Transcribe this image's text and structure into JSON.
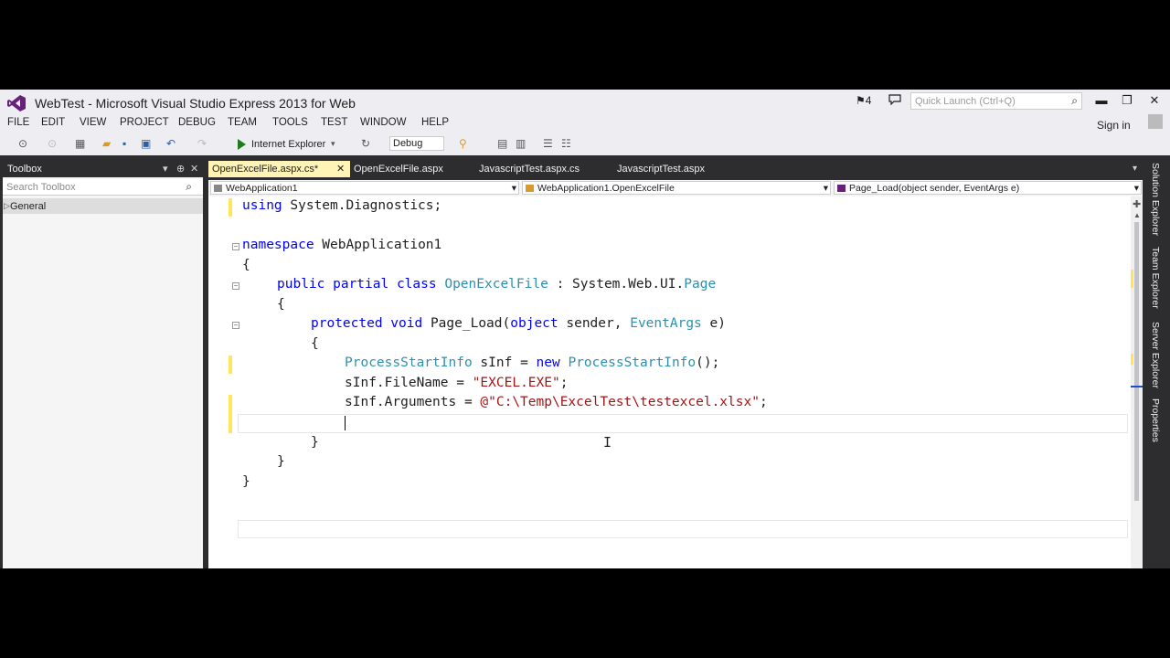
{
  "window": {
    "title": "WebTest - Microsoft Visual Studio Express 2013 for Web",
    "notification_count": "4",
    "quick_launch_placeholder": "Quick Launch (Ctrl+Q)",
    "sign_in": "Sign in"
  },
  "menu": [
    "FILE",
    "EDIT",
    "VIEW",
    "PROJECT",
    "DEBUG",
    "TEAM",
    "TOOLS",
    "TEST",
    "WINDOW",
    "HELP"
  ],
  "toolbar": {
    "browser": "Internet Explorer",
    "config": "Debug"
  },
  "toolbox": {
    "title": "Toolbox",
    "search_placeholder": "Search Toolbox",
    "group": "General"
  },
  "tabs": [
    "OpenExcelFile.aspx.cs*",
    "OpenExcelFile.aspx",
    "JavascriptTest.aspx.cs",
    "JavascriptTest.aspx"
  ],
  "navbar": {
    "project": "WebApplication1",
    "class": "WebApplication1.OpenExcelFile",
    "member": "Page_Load(object sender, EventArgs e)"
  },
  "side_panels": [
    "Solution Explorer",
    "Team Explorer",
    "Server Explorer",
    "Properties"
  ],
  "code": {
    "l1_kw": "using",
    "l1_rest": " System.Diagnostics;",
    "l3_kw": "namespace",
    "l3_rest": " WebApplication1",
    "l4": "{",
    "l5_kw": "public partial class",
    "l5_type": "OpenExcelFile",
    "l5_mid": " : System.Web.UI.",
    "l5_type2": "Page",
    "l6": "{",
    "l7_kw": "protected void",
    "l7_mid": " Page_Load(",
    "l7_kw2": "object",
    "l7_mid2": " sender, ",
    "l7_type": "EventArgs",
    "l7_end": " e)",
    "l8": "{",
    "l9_type": "ProcessStartInfo",
    "l9_mid": " sInf = ",
    "l9_kw": "new",
    "l9_type2": "ProcessStartInfo",
    "l9_end": "();",
    "l10_a": "sInf.FileName = ",
    "l10_str": "\"EXCEL.EXE\"",
    "l10_end": ";",
    "l11_a": "sInf.Arguments = ",
    "l11_str": "@\"C:\\Temp\\ExcelTest\\testexcel.xlsx\"",
    "l11_end": ";",
    "l13": "}",
    "l14": "}",
    "l15": "}"
  }
}
